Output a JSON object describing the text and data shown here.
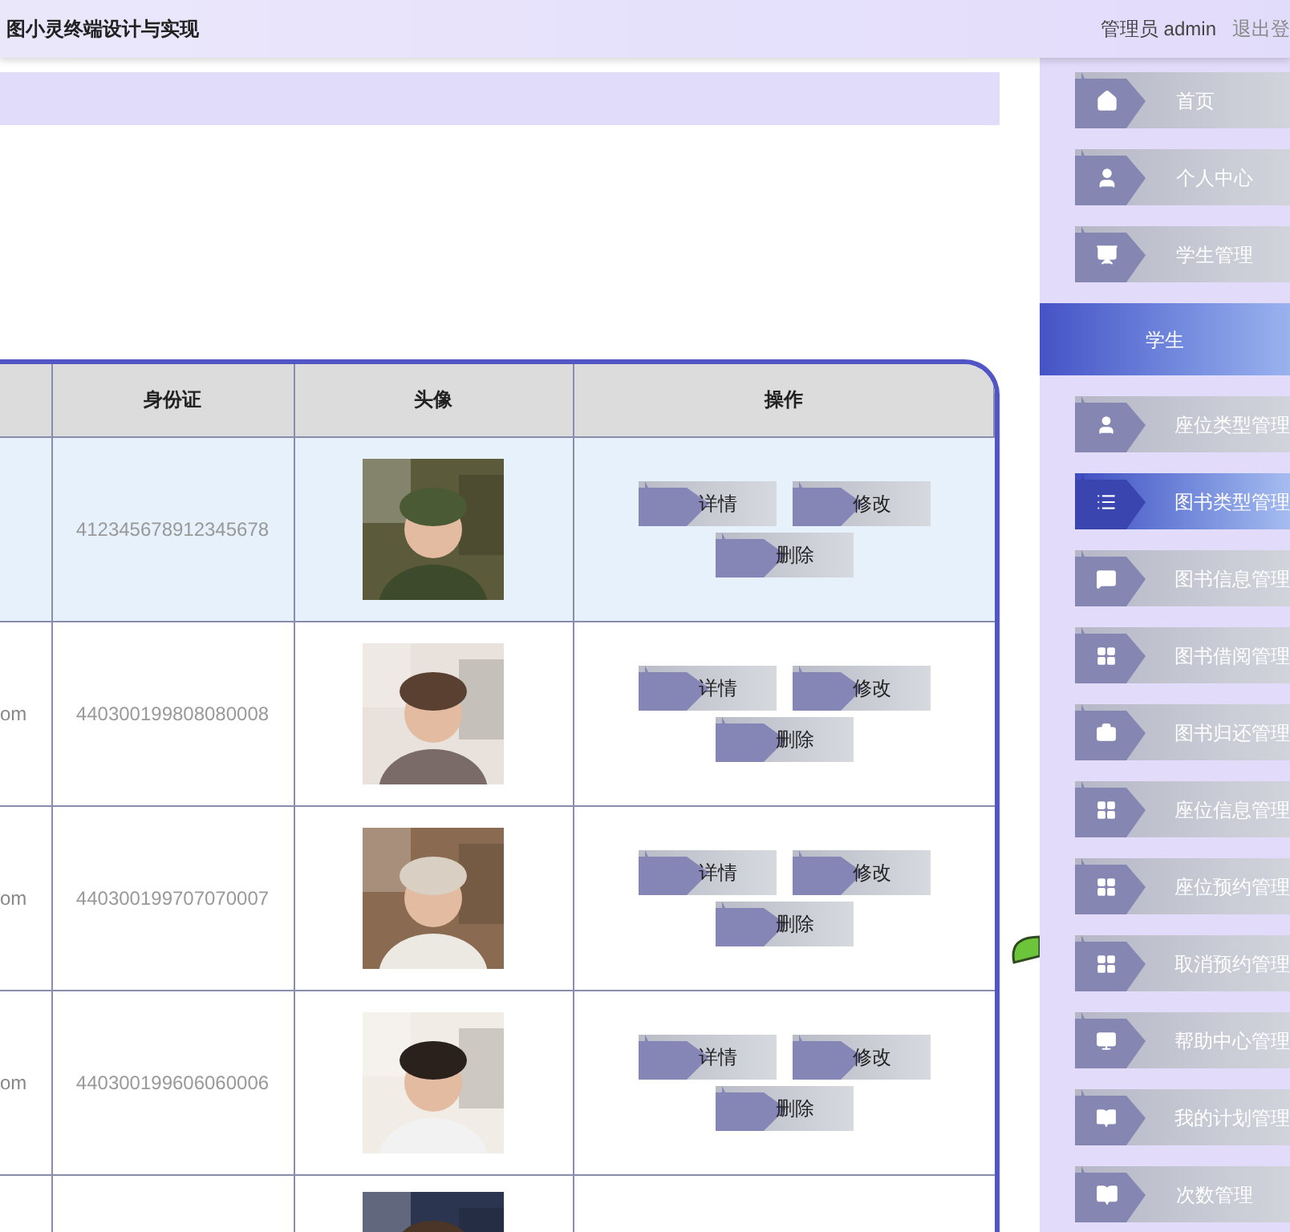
{
  "header": {
    "title": "图小灵终端设计与实现",
    "user": "管理员 admin",
    "logout": "退出登"
  },
  "table": {
    "columns": [
      "",
      "身份证",
      "头像",
      "操作"
    ],
    "rows": [
      {
        "column_1": "",
        "id_card": "412345678912345678",
        "avatar": {
          "kind": "picture"
        },
        "hovered": true,
        "actions": [
          "详情",
          "修改",
          "删除"
        ]
      },
      {
        "column_1": "om",
        "id_card": "440300199808080008",
        "avatar": {
          "kind": "picture"
        },
        "hovered": false,
        "actions": [
          "详情",
          "修改",
          "删除"
        ]
      },
      {
        "column_1": "om",
        "id_card": "440300199707070007",
        "avatar": {
          "kind": "picture"
        },
        "hovered": false,
        "actions": [
          "详情",
          "修改",
          "删除"
        ]
      },
      {
        "column_1": "om",
        "id_card": "440300199606060006",
        "avatar": {
          "kind": "picture"
        },
        "hovered": false,
        "actions": [
          "详情",
          "修改",
          "删除"
        ]
      },
      {
        "column_1": "",
        "id_card": "",
        "avatar": {
          "kind": "picture"
        },
        "hovered": false,
        "actions": []
      }
    ]
  },
  "sidebar": {
    "items": [
      {
        "label": "首页",
        "kind": "menu",
        "selected": false
      },
      {
        "label": "个人中心",
        "kind": "menu",
        "selected": false
      },
      {
        "label": "学生管理",
        "kind": "menu",
        "selected": false
      },
      {
        "label": "学生",
        "kind": "submenu",
        "selected": true
      },
      {
        "label": "座位类型管理",
        "kind": "menu",
        "selected": false
      },
      {
        "label": "图书类型管理",
        "kind": "menu",
        "selected": true
      },
      {
        "label": "图书信息管理",
        "kind": "menu",
        "selected": false
      },
      {
        "label": "图书借阅管理",
        "kind": "menu",
        "selected": false
      },
      {
        "label": "图书归还管理",
        "kind": "menu",
        "selected": false
      },
      {
        "label": "座位信息管理",
        "kind": "menu",
        "selected": false
      },
      {
        "label": "座位预约管理",
        "kind": "menu",
        "selected": false
      },
      {
        "label": "取消预约管理",
        "kind": "menu",
        "selected": false
      },
      {
        "label": "帮助中心管理",
        "kind": "menu",
        "selected": false
      },
      {
        "label": "我的计划管理",
        "kind": "menu",
        "selected": false
      },
      {
        "label": "次数管理",
        "kind": "menu",
        "selected": false
      }
    ]
  }
}
